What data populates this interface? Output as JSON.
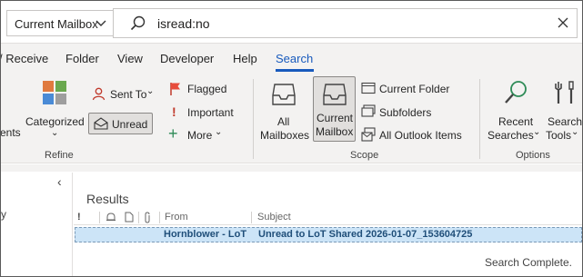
{
  "search": {
    "scope_label": "Current Mailbox",
    "query": "isread:no"
  },
  "tabs": [
    {
      "label": "/ Receive"
    },
    {
      "label": "Folder"
    },
    {
      "label": "View"
    },
    {
      "label": "Developer"
    },
    {
      "label": "Help"
    },
    {
      "label": "Search",
      "active": true
    }
  ],
  "ribbon": {
    "refine": {
      "group_label": "Refine",
      "partial_left": "ents",
      "categorized": "Categorized",
      "sent_to": "Sent To",
      "unread": "Unread",
      "flagged": "Flagged",
      "important": "Important",
      "more": "More"
    },
    "scope": {
      "group_label": "Scope",
      "all_mailboxes_1": "All",
      "all_mailboxes_2": "Mailboxes",
      "current_mailbox_1": "Current",
      "current_mailbox_2": "Mailbox",
      "current_folder": "Current Folder",
      "subfolders": "Subfolders",
      "all_outlook_items": "All Outlook Items"
    },
    "options": {
      "group_label": "Options",
      "recent_1": "Recent",
      "recent_2": "Searches",
      "tools_1": "Search",
      "tools_2": "Tools"
    }
  },
  "results": {
    "title": "Results",
    "columns": {
      "from": "From",
      "subject": "Subject"
    },
    "rows": [
      {
        "from": "Hornblower - LoT",
        "subject": "Unread to LoT Shared 2026-01-07_153604725"
      }
    ],
    "status": "Search Complete."
  },
  "left_pane": {
    "collapse_glyph": "‹",
    "partial_text": "y"
  },
  "colors": {
    "accent": "#185abd",
    "selection": "#cce4f7",
    "ribbon_bg": "#f3f2f1"
  }
}
